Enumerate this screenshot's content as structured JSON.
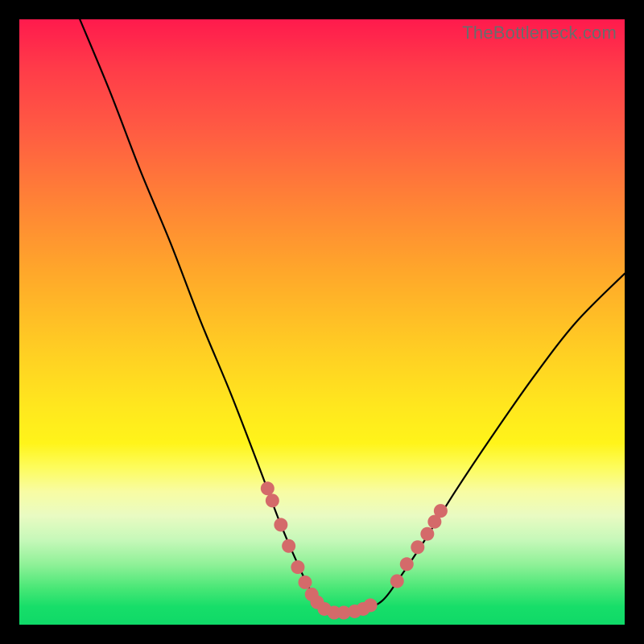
{
  "watermark": "TheBottleneck.com",
  "colors": {
    "marker": "#d46a6a",
    "curve": "#000000",
    "frame_bg_top": "#ff1a4d",
    "frame_bg_bottom": "#0fd968",
    "page_bg": "#000000"
  },
  "chart_data": {
    "type": "line",
    "title": "",
    "xlabel": "",
    "ylabel": "",
    "xlim": [
      0,
      100
    ],
    "ylim": [
      0,
      100
    ],
    "grid": false,
    "series": [
      {
        "name": "curve",
        "x": [
          10,
          15,
          20,
          25,
          30,
          35,
          40,
          43,
          46,
          48.5,
          51,
          53,
          55,
          57,
          60,
          63,
          67,
          72,
          78,
          85,
          92,
          100
        ],
        "y": [
          100,
          88,
          75,
          63,
          50,
          38,
          25,
          17,
          10,
          5,
          2.5,
          2,
          2,
          2.5,
          4,
          8,
          14,
          22,
          31,
          41,
          50,
          58
        ]
      }
    ],
    "markers": [
      {
        "x": 41.0,
        "y": 22.5
      },
      {
        "x": 41.8,
        "y": 20.5
      },
      {
        "x": 43.2,
        "y": 16.5
      },
      {
        "x": 44.5,
        "y": 13.0
      },
      {
        "x": 46.0,
        "y": 9.5
      },
      {
        "x": 47.2,
        "y": 7.0
      },
      {
        "x": 48.3,
        "y": 5.0
      },
      {
        "x": 49.2,
        "y": 3.7
      },
      {
        "x": 50.4,
        "y": 2.6
      },
      {
        "x": 52.0,
        "y": 2.0
      },
      {
        "x": 53.6,
        "y": 2.0
      },
      {
        "x": 55.4,
        "y": 2.2
      },
      {
        "x": 56.8,
        "y": 2.6
      },
      {
        "x": 58.0,
        "y": 3.2
      },
      {
        "x": 62.4,
        "y": 7.2
      },
      {
        "x": 64.0,
        "y": 10.0
      },
      {
        "x": 65.8,
        "y": 12.8
      },
      {
        "x": 67.4,
        "y": 15.0
      },
      {
        "x": 68.6,
        "y": 17.0
      },
      {
        "x": 69.6,
        "y": 18.8
      }
    ]
  }
}
